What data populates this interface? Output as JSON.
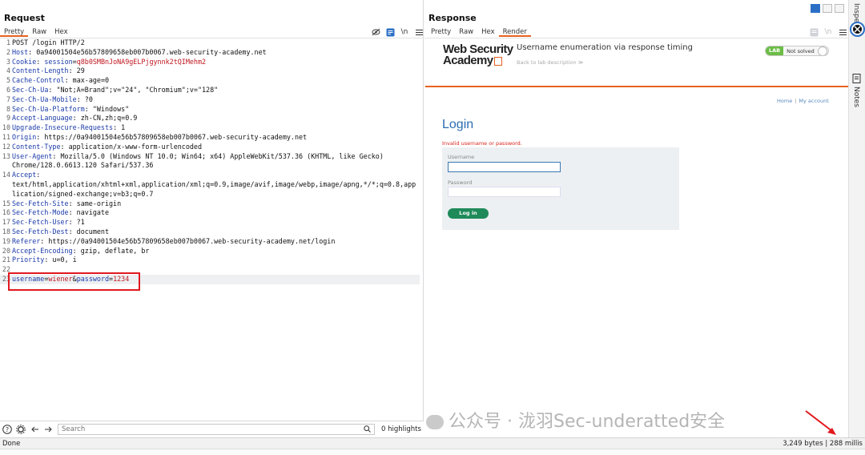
{
  "request": {
    "title": "Request",
    "tabs": [
      "Pretty",
      "Raw",
      "Hex"
    ],
    "active_tab": "Pretty",
    "tools": [
      "eye-slash-icon",
      "wrap-icon",
      "newline-icon",
      "menu-icon"
    ],
    "newline_label": "\\n",
    "lines": [
      {
        "n": "1",
        "key": "",
        "val": "POST /login HTTP/2"
      },
      {
        "n": "2",
        "key": "Host",
        "val": ": 0a94001504e56b57809658eb007b0067.web-security-academy.net"
      },
      {
        "n": "3",
        "key": "Cookie",
        "val": ": ",
        "ck": "session",
        "cv": "q8b0SMBnJoNA9gELPjgynnk2tQIMehm2"
      },
      {
        "n": "4",
        "key": "Content-Length",
        "val": ": 29"
      },
      {
        "n": "5",
        "key": "Cache-Control",
        "val": ": max-age=0"
      },
      {
        "n": "6",
        "key": "Sec-Ch-Ua",
        "val": ": \"Not;A=Brand\";v=\"24\", \"Chromium\";v=\"128\""
      },
      {
        "n": "7",
        "key": "Sec-Ch-Ua-Mobile",
        "val": ": ?0"
      },
      {
        "n": "8",
        "key": "Sec-Ch-Ua-Platform",
        "val": ": \"Windows\""
      },
      {
        "n": "9",
        "key": "Accept-Language",
        "val": ": zh-CN,zh;q=0.9"
      },
      {
        "n": "10",
        "key": "Upgrade-Insecure-Requests",
        "val": ": 1"
      },
      {
        "n": "11",
        "key": "Origin",
        "val": ": https://0a94001504e56b57809658eb007b0067.web-security-academy.net"
      },
      {
        "n": "12",
        "key": "Content-Type",
        "val": ": application/x-www-form-urlencoded"
      },
      {
        "n": "13",
        "key": "User-Agent",
        "val": ": Mozilla/5.0 (Windows NT 10.0; Win64; x64) AppleWebKit/537.36 (KHTML, like Gecko)"
      },
      {
        "n": "",
        "key": "",
        "val": "Chrome/128.0.6613.120 Safari/537.36"
      },
      {
        "n": "14",
        "key": "Accept",
        "val": ":"
      },
      {
        "n": "",
        "key": "",
        "val": "text/html,application/xhtml+xml,application/xml;q=0.9,image/avif,image/webp,image/apng,*/*;q=0.8,app"
      },
      {
        "n": "",
        "key": "",
        "val": "lication/signed-exchange;v=b3;q=0.7"
      },
      {
        "n": "15",
        "key": "Sec-Fetch-Site",
        "val": ": same-origin"
      },
      {
        "n": "16",
        "key": "Sec-Fetch-Mode",
        "val": ": navigate"
      },
      {
        "n": "17",
        "key": "Sec-Fetch-User",
        "val": ": ?1"
      },
      {
        "n": "18",
        "key": "Sec-Fetch-Dest",
        "val": ": document"
      },
      {
        "n": "19",
        "key": "Referer",
        "val": ": https://0a94001504e56b57809658eb007b0067.web-security-academy.net/login"
      },
      {
        "n": "20",
        "key": "Accept-Encoding",
        "val": ": gzip, deflate, br"
      },
      {
        "n": "21",
        "key": "Priority",
        "val": ": u=0, i"
      },
      {
        "n": "22",
        "key": "",
        "val": ""
      }
    ],
    "body_line": {
      "n": "23",
      "k1": "username",
      "v1": "wiener",
      "amp": "&",
      "k2": "password",
      "v2": "1234",
      "eq": "="
    },
    "search_placeholder": "Search",
    "highlights": "0 highlights"
  },
  "response": {
    "title": "Response",
    "tabs": [
      "Pretty",
      "Raw",
      "Hex",
      "Render"
    ],
    "active_tab": "Render",
    "page": {
      "logo_line1": "Web Security",
      "logo_line2": "Academy",
      "lab_title": "Username enumeration via response timing",
      "back_link": "Back to lab description  ≫",
      "lab_badge": "LAB",
      "status": "Not solved",
      "nav_home": "Home",
      "nav_sep": "|",
      "nav_account": "My account",
      "heading": "Login",
      "error": "Invalid username or password.",
      "username_label": "Username",
      "password_label": "Password",
      "login_button": "Log in"
    }
  },
  "sidebar": {
    "inspector": "Inspector",
    "notes": "Notes"
  },
  "status_bar": {
    "left": "Done",
    "right": "3,249 bytes | 288 millis"
  },
  "watermark": "公众号 · 泷羽Sec-underatted安全",
  "colors": {
    "accent": "#e8621f",
    "header_key": "#1a3aa8",
    "highlight_red": "#c0161f",
    "lab_green": "#6bbd45",
    "login_blue": "#2b6cb0",
    "button_green": "#1e8a5a"
  }
}
